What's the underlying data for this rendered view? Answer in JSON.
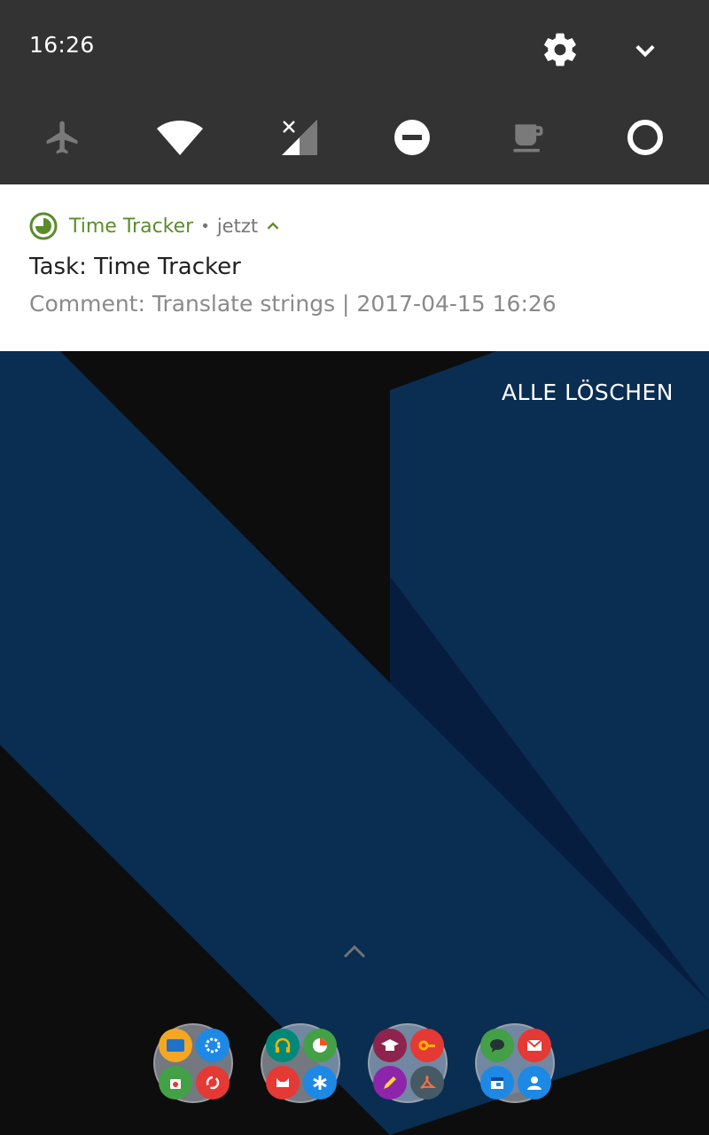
{
  "status": {
    "time": "16:26"
  },
  "quick_settings": [
    {
      "name": "airplane-mode",
      "icon": "airplane-icon",
      "enabled": false
    },
    {
      "name": "wifi",
      "icon": "wifi-icon",
      "enabled": true
    },
    {
      "name": "mobile-data",
      "icon": "signal-no-sim-icon",
      "enabled": false
    },
    {
      "name": "do-not-disturb",
      "icon": "minus-circle-icon",
      "enabled": true
    },
    {
      "name": "caffeine",
      "icon": "coffee-cup-icon",
      "enabled": false
    },
    {
      "name": "rotation",
      "icon": "ring-icon",
      "enabled": true
    }
  ],
  "notification": {
    "app_name": "Time Tracker",
    "separator": "•",
    "time": "jetzt",
    "title": "Task: Time Tracker",
    "text": "Comment: Translate strings | 2017-04-15 16:26",
    "accent": "#5b8c2a"
  },
  "actions": {
    "clear_all": "ALLE LÖSCHEN"
  },
  "colors": {
    "shade": "#333333",
    "wallpaper_blue": "#0a2d52",
    "wallpaper_dark": "#0d0d0d"
  },
  "dock_folders": [
    {
      "apps": [
        "folder-icon",
        "settings-icon",
        "store-icon",
        "sync-icon"
      ]
    },
    {
      "apps": [
        "headphones-icon",
        "browser-icon",
        "cat-icon",
        "asterisk-icon"
      ]
    },
    {
      "apps": [
        "graduation-icon",
        "key-icon",
        "pencil-icon",
        "pdf-icon"
      ]
    },
    {
      "apps": [
        "chat-icon",
        "mail-icon",
        "calendar-icon",
        "contact-icon"
      ]
    }
  ]
}
